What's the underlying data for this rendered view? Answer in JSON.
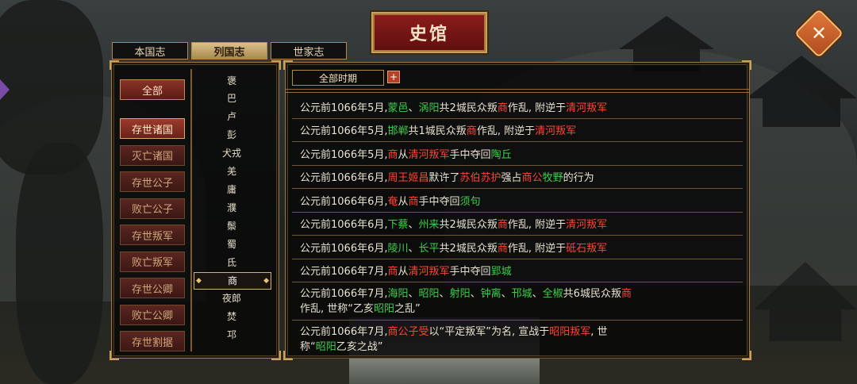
{
  "title": "史馆",
  "close_label": "✕",
  "tabs": [
    "本国志",
    "列国志",
    "世家志"
  ],
  "active_tab_index": 1,
  "categories": {
    "all_label": "全部",
    "items": [
      "存世诸国",
      "灭亡诸国",
      "存世公子",
      "败亡公子",
      "存世叛军",
      "败亡叛军",
      "存世公卿",
      "败亡公卿",
      "存世割据"
    ],
    "active_index": 0
  },
  "nations": {
    "items": [
      "褒",
      "巴",
      "卢",
      "彭",
      "犬戎",
      "羌",
      "庸",
      "濮",
      "鬃",
      "蜀",
      "氐",
      "商",
      "夜郎",
      "焚",
      "邛"
    ],
    "selected_index": 11
  },
  "period_filter": {
    "label": "全部时期",
    "plus": "+"
  },
  "colors": {
    "place": "#3fce4c",
    "faction": "#ff4433",
    "accent": "#c9a15a"
  },
  "entries": [
    {
      "lines": [
        [
          {
            "t": "公元前1066年5月,"
          },
          {
            "t": "蒙邑",
            "c": "g"
          },
          {
            "t": "、"
          },
          {
            "t": "涡阳",
            "c": "g"
          },
          {
            "t": "共2城民众叛"
          },
          {
            "t": "商",
            "c": "r"
          },
          {
            "t": "作乱, 附逆于"
          },
          {
            "t": "清河叛军",
            "c": "r"
          }
        ]
      ]
    },
    {
      "lines": [
        [
          {
            "t": "公元前1066年5月,"
          },
          {
            "t": "邯郸",
            "c": "g"
          },
          {
            "t": "共1城民众叛"
          },
          {
            "t": "商",
            "c": "r"
          },
          {
            "t": "作乱, 附逆于"
          },
          {
            "t": "清河叛军",
            "c": "r"
          }
        ]
      ]
    },
    {
      "lines": [
        [
          {
            "t": "公元前1066年5月,"
          },
          {
            "t": "商",
            "c": "r"
          },
          {
            "t": "从"
          },
          {
            "t": "清河叛军",
            "c": "r"
          },
          {
            "t": "手中夺回"
          },
          {
            "t": "陶丘",
            "c": "g"
          }
        ]
      ]
    },
    {
      "lines": [
        [
          {
            "t": "公元前1066年6月,"
          },
          {
            "t": "周王姬昌",
            "c": "r"
          },
          {
            "t": "默许了"
          },
          {
            "t": "苏伯苏护",
            "c": "r"
          },
          {
            "t": "强占"
          },
          {
            "t": "商公",
            "c": "r"
          },
          {
            "t": "牧野",
            "c": "g"
          },
          {
            "t": "的行为"
          }
        ]
      ]
    },
    {
      "lines": [
        [
          {
            "t": "公元前1066年6月,"
          },
          {
            "t": "奄",
            "c": "r"
          },
          {
            "t": "从"
          },
          {
            "t": "商",
            "c": "r"
          },
          {
            "t": "手中夺回"
          },
          {
            "t": "须句",
            "c": "g"
          }
        ]
      ]
    },
    {
      "lines": [
        [
          {
            "t": "公元前1066年6月,"
          },
          {
            "t": "下蔡",
            "c": "g"
          },
          {
            "t": "、"
          },
          {
            "t": "州来",
            "c": "g"
          },
          {
            "t": "共2城民众叛"
          },
          {
            "t": "商",
            "c": "r"
          },
          {
            "t": "作乱, 附逆于"
          },
          {
            "t": "清河叛军",
            "c": "r"
          }
        ]
      ]
    },
    {
      "lines": [
        [
          {
            "t": "公元前1066年6月,"
          },
          {
            "t": "陵川",
            "c": "g"
          },
          {
            "t": "、"
          },
          {
            "t": "长平",
            "c": "g"
          },
          {
            "t": "共2城民众叛"
          },
          {
            "t": "商",
            "c": "r"
          },
          {
            "t": "作乱, 附逆于"
          },
          {
            "t": "砥石叛军",
            "c": "r"
          }
        ]
      ]
    },
    {
      "lines": [
        [
          {
            "t": "公元前1066年7月,"
          },
          {
            "t": "商",
            "c": "r"
          },
          {
            "t": "从"
          },
          {
            "t": "清河叛军",
            "c": "r"
          },
          {
            "t": "手中夺回"
          },
          {
            "t": "郢城",
            "c": "g"
          }
        ]
      ]
    },
    {
      "lines": [
        [
          {
            "t": "公元前1066年7月,"
          },
          {
            "t": "海阳",
            "c": "g"
          },
          {
            "t": "、"
          },
          {
            "t": "昭阳",
            "c": "g"
          },
          {
            "t": "、"
          },
          {
            "t": "射阳",
            "c": "g"
          },
          {
            "t": "、"
          },
          {
            "t": "钟离",
            "c": "g"
          },
          {
            "t": "、"
          },
          {
            "t": "邗城",
            "c": "g"
          },
          {
            "t": "、"
          },
          {
            "t": "全椒",
            "c": "g"
          },
          {
            "t": "共6城民众叛"
          },
          {
            "t": "商",
            "c": "r"
          }
        ],
        [
          {
            "t": "作乱, 世称“乙亥"
          },
          {
            "t": "昭阳",
            "c": "g"
          },
          {
            "t": "之乱”"
          }
        ]
      ]
    },
    {
      "lines": [
        [
          {
            "t": "公元前1066年7月,"
          },
          {
            "t": "商公子受",
            "c": "r"
          },
          {
            "t": "以“平定叛军”为名, 宣战于"
          },
          {
            "t": "昭阳叛军",
            "c": "r"
          },
          {
            "t": ", 世"
          }
        ],
        [
          {
            "t": "称“"
          },
          {
            "t": "昭阳",
            "c": "g"
          },
          {
            "t": "乙亥之战”"
          }
        ]
      ]
    }
  ]
}
